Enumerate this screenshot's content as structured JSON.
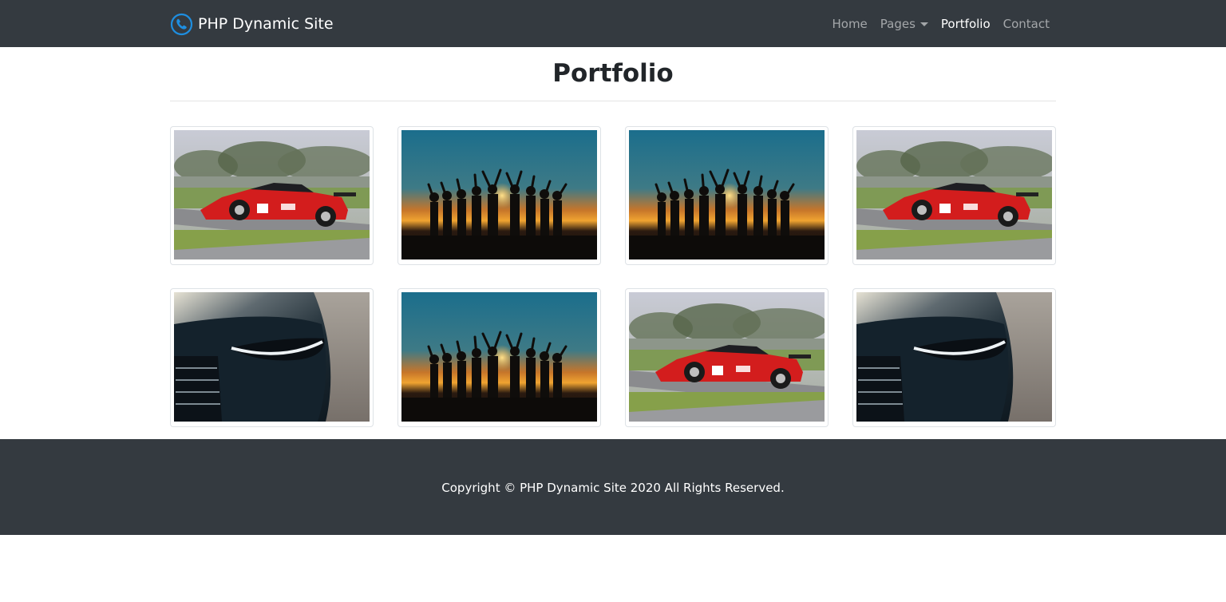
{
  "brand": {
    "name": "PHP Dynamic Site",
    "logo_icon": "phone-in-circle-icon",
    "accent": "#1e8ee0"
  },
  "nav": {
    "home": "Home",
    "pages": "Pages",
    "portfolio": "Portfolio",
    "contact": "Contact",
    "active": "portfolio"
  },
  "main": {
    "title": "Portfolio"
  },
  "gallery": {
    "items": [
      {
        "subject": "red race car"
      },
      {
        "subject": "people silhouettes at sunset"
      },
      {
        "subject": "people silhouettes at sunset"
      },
      {
        "subject": "red race car"
      },
      {
        "subject": "black car headlight"
      },
      {
        "subject": "people silhouettes at sunset"
      },
      {
        "subject": "red race car"
      },
      {
        "subject": "black car headlight"
      }
    ]
  },
  "footer": {
    "copyright": "Copyright © PHP Dynamic Site 2020 All Rights Reserved."
  },
  "colors": {
    "navbar_bg": "#343a40",
    "footer_bg": "#343a40",
    "title": "#212529"
  }
}
